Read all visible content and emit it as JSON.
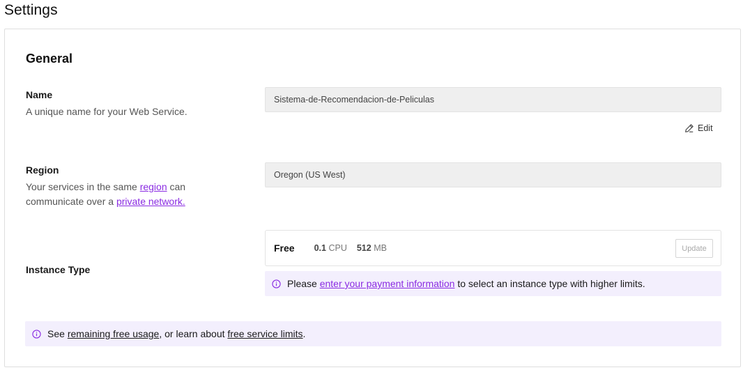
{
  "page": {
    "title": "Settings"
  },
  "general": {
    "title": "General",
    "name": {
      "label": "Name",
      "description": "A unique name for your Web Service.",
      "value": "Sistema-de-Recomendacion-de-Peliculas",
      "edit_label": "Edit"
    },
    "region": {
      "label": "Region",
      "desc_part1": "Your services in the same ",
      "desc_link1": "region",
      "desc_part2": " can communicate over a ",
      "desc_link2": "private network.",
      "value": "Oregon (US West)"
    },
    "instance": {
      "label": "Instance Type",
      "plan": "Free",
      "cpu_value": "0.1",
      "cpu_unit": "CPU",
      "mem_value": "512",
      "mem_unit": "MB",
      "update_label": "Update",
      "payment_prefix": "Please ",
      "payment_link": "enter your payment information",
      "payment_suffix": " to select an instance type with higher limits."
    },
    "usage_notice": {
      "prefix": "See ",
      "link1": "remaining free usage",
      "middle": ", or learn about ",
      "link2": "free service limits",
      "suffix": "."
    }
  },
  "colors": {
    "accent": "#8a2be2",
    "notice_bg": "#f3effd",
    "input_bg": "#efefef"
  },
  "icons": {
    "edit": "pencil-icon",
    "info": "info-circle-icon"
  }
}
